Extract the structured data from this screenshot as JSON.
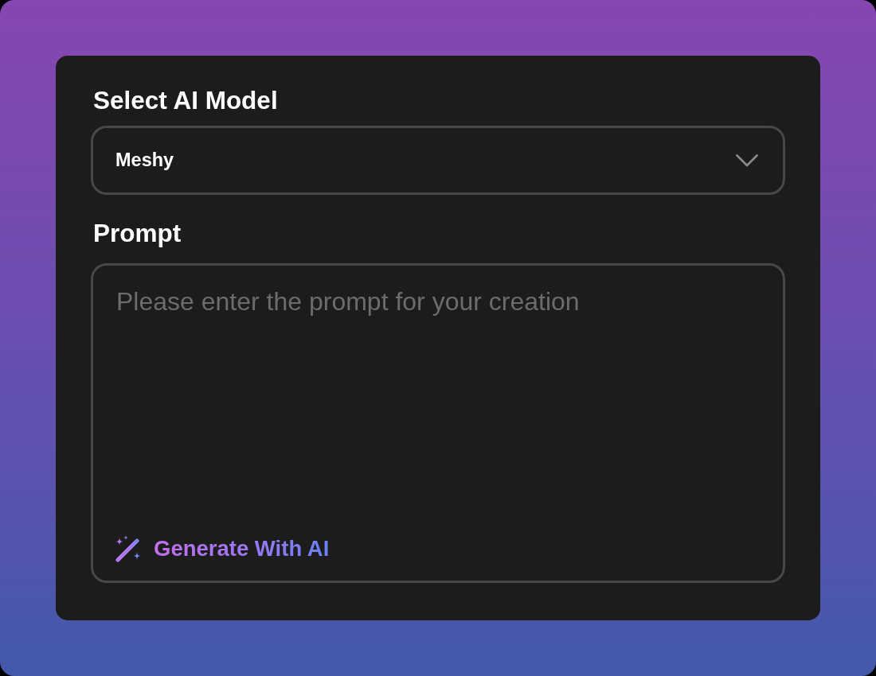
{
  "model_select": {
    "label": "Select AI Model",
    "value": "Meshy"
  },
  "prompt": {
    "label": "Prompt",
    "placeholder": "Please enter the prompt for your creation",
    "action": {
      "label": "Generate With AI"
    }
  }
}
